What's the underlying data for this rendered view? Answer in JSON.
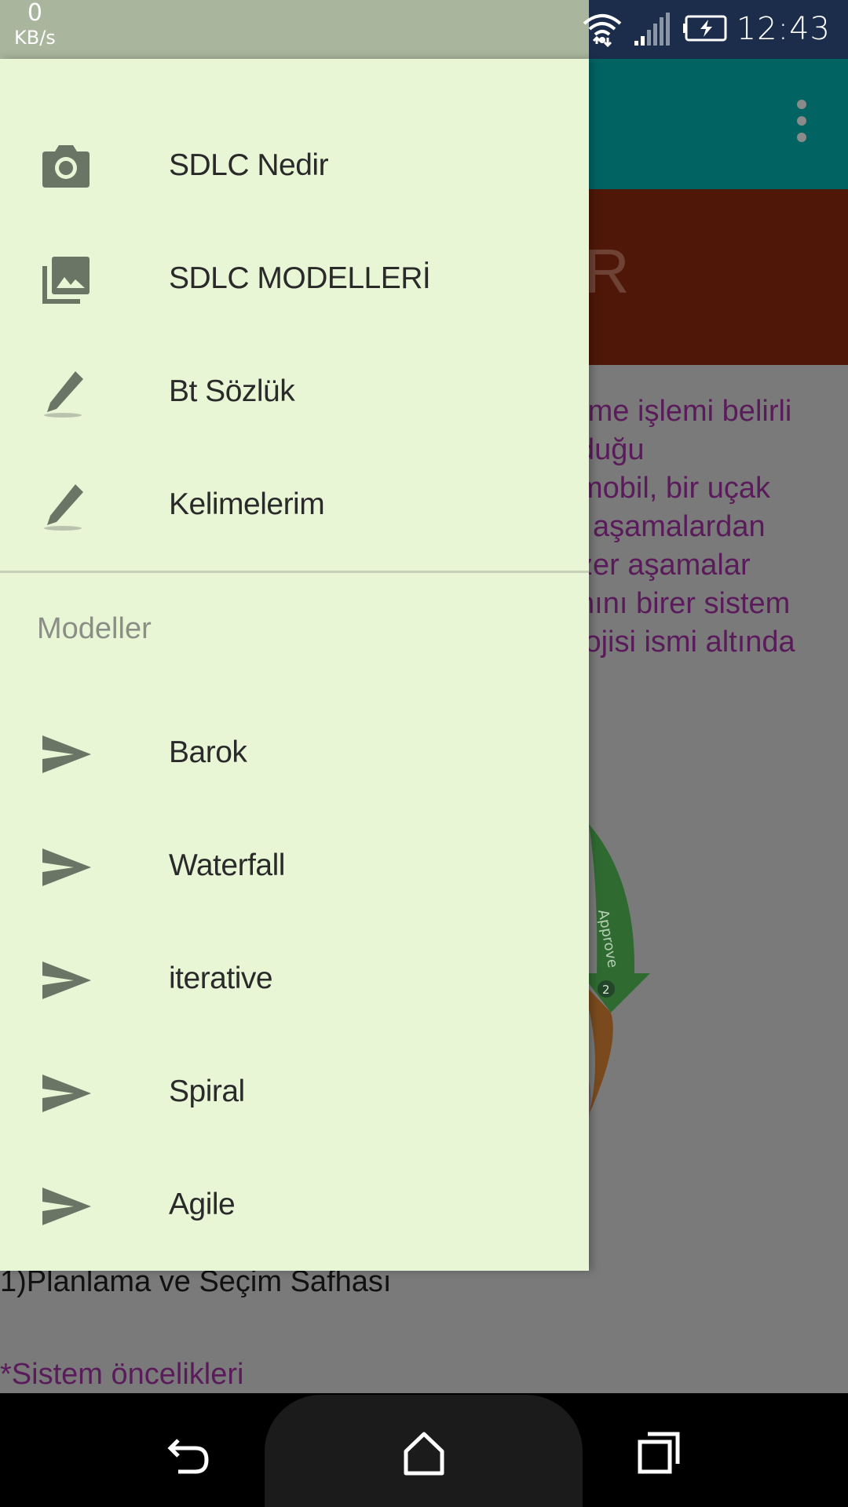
{
  "status_bar": {
    "net_speed_value": "0",
    "net_speed_unit": "KB/s",
    "time": "12:43",
    "icons": [
      "wifi-icon",
      "signal-icon",
      "battery-charging-icon"
    ]
  },
  "app": {
    "menu_icon": "overflow-menu-icon",
    "banner_text": "R",
    "body_lines": [
      "rme işlemi belirli",
      "duğu",
      "mobil, bir uçak",
      "i aşamalardan",
      "zer aşamalar",
      "nını birer sistem",
      "lojisi ismi altında"
    ],
    "diagram_text": "Approve",
    "diagram_step": "2",
    "phase_heading": "1)Planlama ve Seçim Safhası",
    "priority_item": "*Sistem öncelikleri"
  },
  "drawer": {
    "items": [
      {
        "label": "SDLC Nedir",
        "icon": "camera-icon"
      },
      {
        "label": "SDLC MODELLERİ",
        "icon": "photo-library-icon"
      },
      {
        "label": "Bt Sözlük",
        "icon": "pencil-icon"
      },
      {
        "label": "Kelimelerim",
        "icon": "pencil-icon"
      }
    ],
    "section_title": "Modeller",
    "models": [
      {
        "label": "Barok",
        "icon": "send-icon"
      },
      {
        "label": "Waterfall",
        "icon": "send-icon"
      },
      {
        "label": "iterative",
        "icon": "send-icon"
      },
      {
        "label": "Spiral",
        "icon": "send-icon"
      },
      {
        "label": "Agile",
        "icon": "send-icon"
      }
    ]
  },
  "nav_bar": {
    "buttons": [
      "back-icon",
      "home-icon",
      "recents-icon"
    ]
  },
  "colors": {
    "drawer_bg": "#e9f6d6",
    "app_bar": "#026363",
    "banner": "#4f1707",
    "icon": "#6b7565"
  }
}
